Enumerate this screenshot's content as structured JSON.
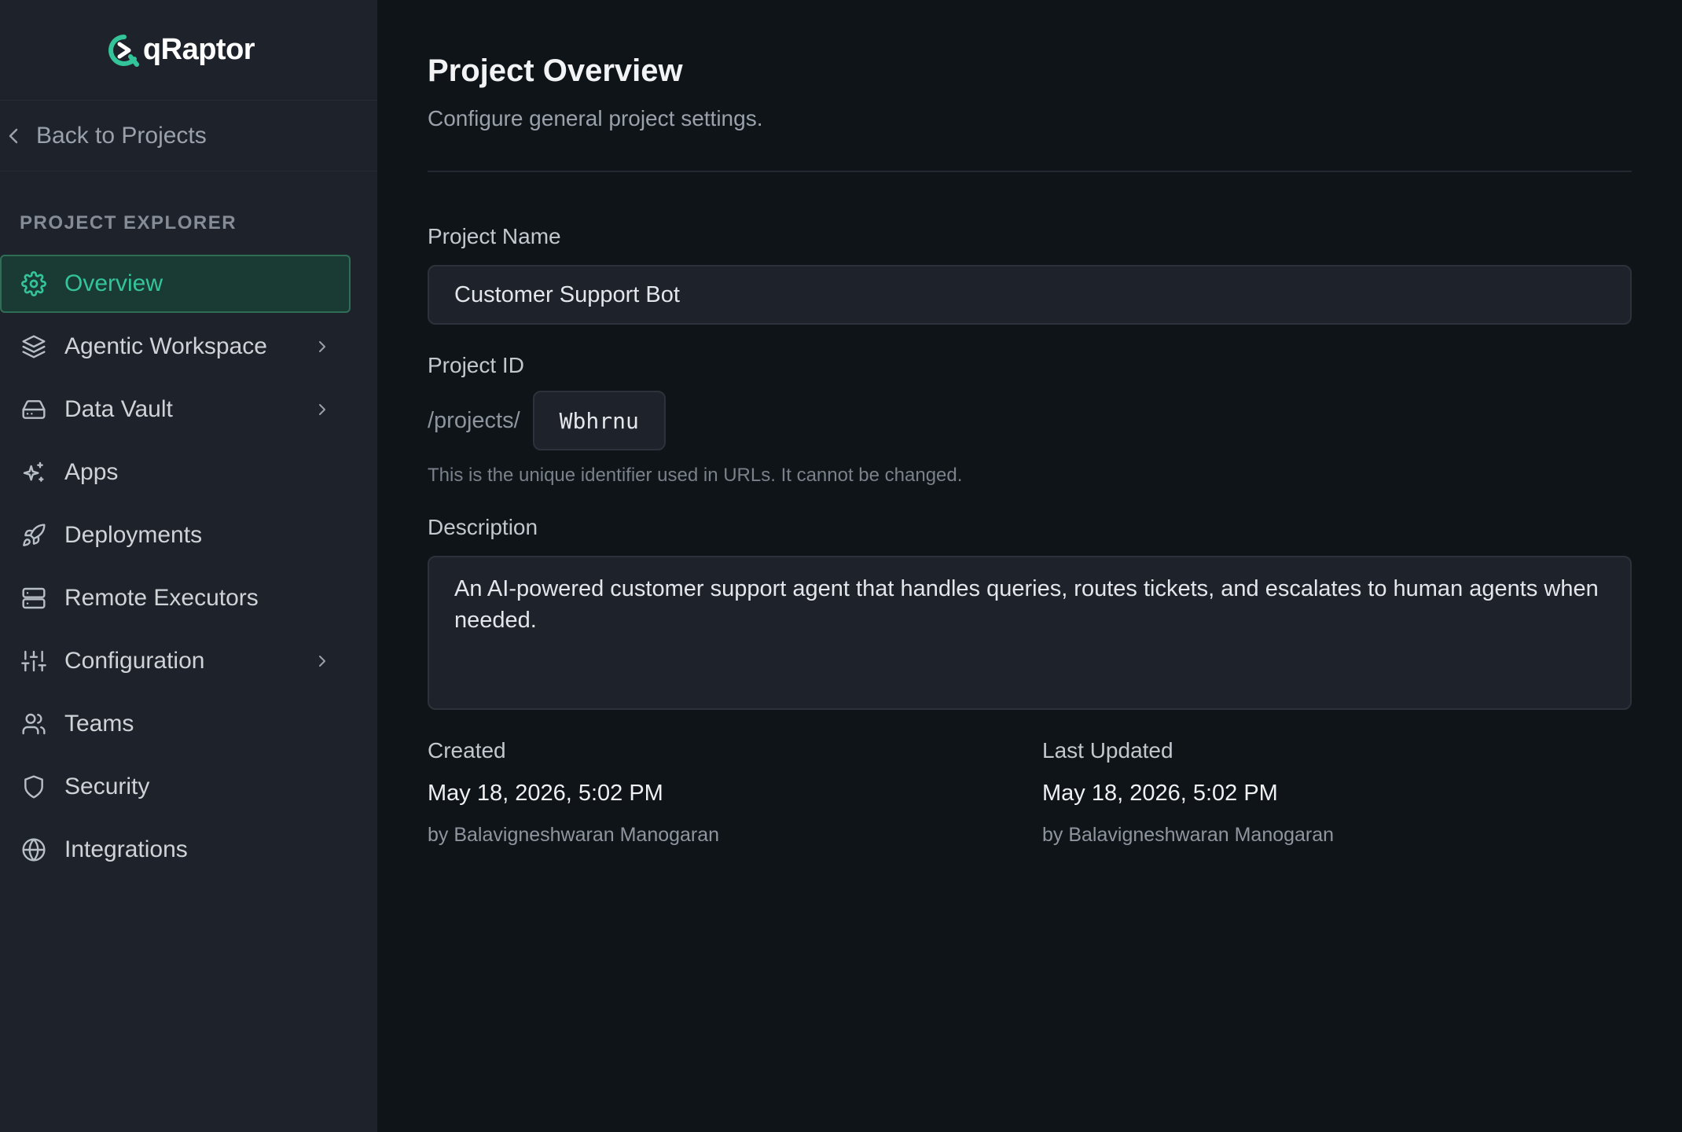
{
  "brand": {
    "name": "qRaptor"
  },
  "sidebar": {
    "back_label": "Back to Projects",
    "section_title": "PROJECT EXPLORER",
    "items": [
      {
        "label": "Overview",
        "icon": "gear-icon",
        "active": true,
        "has_children": false
      },
      {
        "label": "Agentic Workspace",
        "icon": "layers-icon",
        "active": false,
        "has_children": true
      },
      {
        "label": "Data Vault",
        "icon": "hard-drive-icon",
        "active": false,
        "has_children": true
      },
      {
        "label": "Apps",
        "icon": "sparkles-icon",
        "active": false,
        "has_children": false
      },
      {
        "label": "Deployments",
        "icon": "rocket-icon",
        "active": false,
        "has_children": false
      },
      {
        "label": "Remote Executors",
        "icon": "server-icon",
        "active": false,
        "has_children": false
      },
      {
        "label": "Configuration",
        "icon": "sliders-icon",
        "active": false,
        "has_children": true
      },
      {
        "label": "Teams",
        "icon": "users-icon",
        "active": false,
        "has_children": false
      },
      {
        "label": "Security",
        "icon": "shield-icon",
        "active": false,
        "has_children": false
      },
      {
        "label": "Integrations",
        "icon": "globe-icon",
        "active": false,
        "has_children": false
      }
    ]
  },
  "main": {
    "title": "Project Overview",
    "subtitle": "Configure general project settings.",
    "project_name": {
      "label": "Project Name",
      "value": "Customer Support Bot"
    },
    "project_id": {
      "label": "Project ID",
      "prefix": "/projects/",
      "value": "Wbhrnu",
      "help": "This is the unique identifier used in URLs. It cannot be changed."
    },
    "description": {
      "label": "Description",
      "value": "An AI-powered customer support agent that handles queries, routes tickets, and escalates to human agents when needed."
    },
    "created": {
      "label": "Created",
      "date": "May 18, 2026, 5:02 PM",
      "by": "by Balavigneshwaran Manogaran"
    },
    "updated": {
      "label": "Last Updated",
      "date": "May 18, 2026, 5:02 PM",
      "by": "by Balavigneshwaran Manogaran"
    }
  },
  "colors": {
    "accent": "#34c49a",
    "sidebar_bg": "#1e232b",
    "main_bg": "#0f1418"
  }
}
